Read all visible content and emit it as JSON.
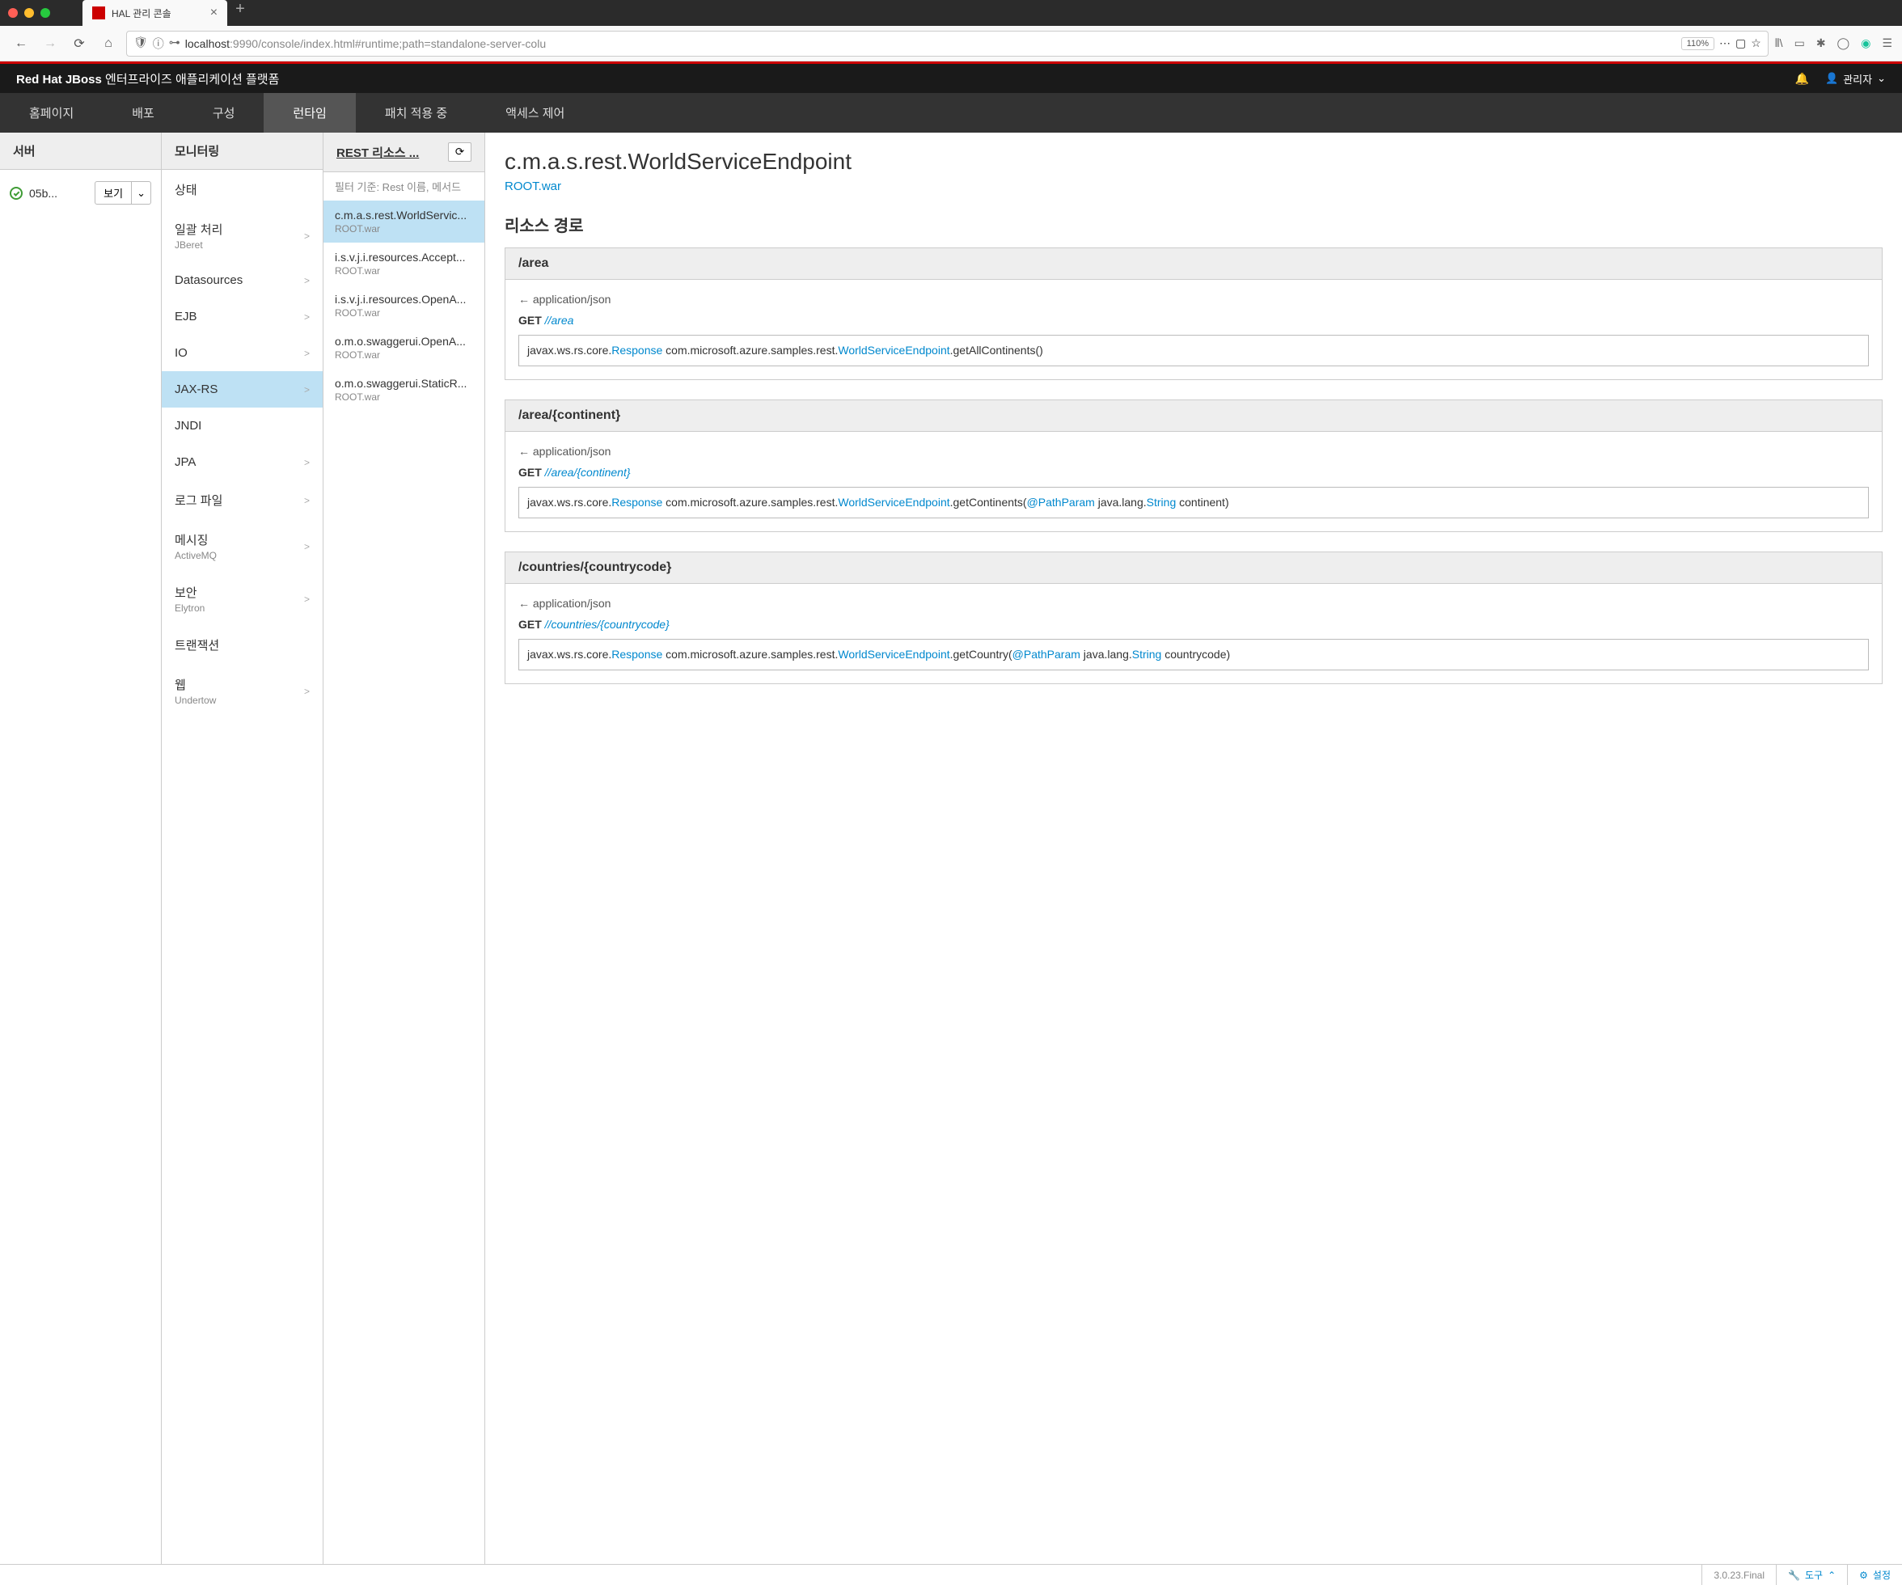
{
  "browser": {
    "tab_title": "HAL 관리 콘솔",
    "url_host": "localhost",
    "url_path": ":9990/console/index.html#runtime;path=standalone-server-colu",
    "zoom": "110%"
  },
  "header": {
    "brand_bold": "Red Hat JBoss",
    "brand_rest": " 엔터프라이즈 애플리케이션 플랫폼",
    "user_label": "관리자"
  },
  "nav": {
    "items": [
      "홈페이지",
      "배포",
      "구성",
      "런타임",
      "패치 적용 중",
      "액세스 제어"
    ],
    "active_index": 3
  },
  "col1": {
    "header": "서버",
    "server_name": "05b...",
    "view_btn": "보기"
  },
  "col2": {
    "header": "모니터링",
    "items": [
      {
        "label": "상태",
        "sub": "",
        "chevron": false
      },
      {
        "label": "일괄 처리",
        "sub": "JBeret",
        "chevron": true
      },
      {
        "label": "Datasources",
        "sub": "",
        "chevron": true
      },
      {
        "label": "EJB",
        "sub": "",
        "chevron": true
      },
      {
        "label": "IO",
        "sub": "",
        "chevron": true
      },
      {
        "label": "JAX-RS",
        "sub": "",
        "chevron": true
      },
      {
        "label": "JNDI",
        "sub": "",
        "chevron": false
      },
      {
        "label": "JPA",
        "sub": "",
        "chevron": true
      },
      {
        "label": "로그 파일",
        "sub": "",
        "chevron": true
      },
      {
        "label": "메시징",
        "sub": "ActiveMQ",
        "chevron": true
      },
      {
        "label": "보안",
        "sub": "Elytron",
        "chevron": true
      },
      {
        "label": "트랜잭션",
        "sub": "",
        "chevron": false
      },
      {
        "label": "웹",
        "sub": "Undertow",
        "chevron": true
      }
    ],
    "active_index": 5
  },
  "col3": {
    "header": "REST 리소스 ...",
    "filter_placeholder": "필터 기준: Rest 이름, 메서드",
    "items": [
      {
        "title": "c.m.a.s.rest.WorldServic...",
        "sub": "ROOT.war"
      },
      {
        "title": "i.s.v.j.i.resources.Accept...",
        "sub": "ROOT.war"
      },
      {
        "title": "i.s.v.j.i.resources.OpenA...",
        "sub": "ROOT.war"
      },
      {
        "title": "o.m.o.swaggerui.OpenA...",
        "sub": "ROOT.war"
      },
      {
        "title": "o.m.o.swaggerui.StaticR...",
        "sub": "ROOT.war"
      }
    ],
    "active_index": 0
  },
  "detail": {
    "title": "c.m.a.s.rest.WorldServiceEndpoint",
    "subtitle_link": "ROOT.war",
    "section_title": "리소스 경로",
    "resources": [
      {
        "path": "/area",
        "accept": "← application/json",
        "method": "GET",
        "method_path": "//area",
        "code_parts": {
          "p1": "javax.ws.rs.core.",
          "l1": "Response",
          "p2": "  com.microsoft.azure.samples.rest.",
          "l2": "WorldServiceEndpoint",
          "p3": ".getAllContinents()"
        }
      },
      {
        "path": "/area/{continent}",
        "accept": "← application/json",
        "method": "GET",
        "method_path": "//area/{continent}",
        "code_parts": {
          "p1": "javax.ws.rs.core.",
          "l1": "Response",
          "p2": "  com.microsoft.azure.samples.rest.",
          "l2": "WorldServiceEndpoint",
          "p3": ".getContinents(",
          "l3": "@PathParam",
          "p4": "  java.lang.",
          "l4": "String",
          "p5": "  continent)"
        }
      },
      {
        "path": "/countries/{countrycode}",
        "accept": "← application/json",
        "method": "GET",
        "method_path": "//countries/{countrycode}",
        "code_parts": {
          "p1": "javax.ws.rs.core.",
          "l1": "Response",
          "p2": "  com.microsoft.azure.samples.rest.",
          "l2": "WorldServiceEndpoint",
          "p3": ".getCountry(",
          "l3": "@PathParam",
          "p4": "  java.lang.",
          "l4": "String",
          "p5": "  countrycode)"
        }
      }
    ]
  },
  "footer": {
    "version": "3.0.23.Final",
    "tools": "도구",
    "settings": "설정"
  }
}
